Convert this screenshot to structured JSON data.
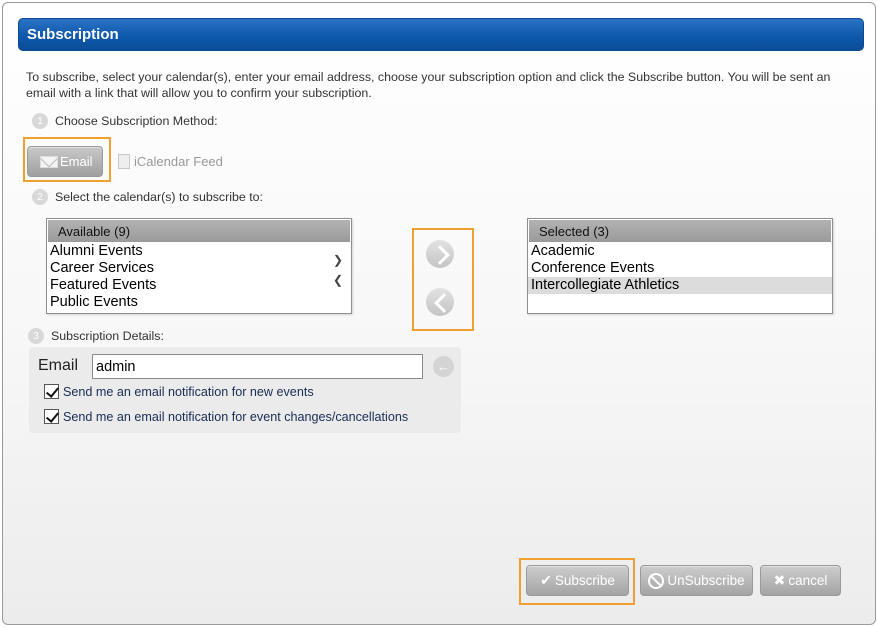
{
  "dialog": {
    "title": "Subscription"
  },
  "intro": "To subscribe, select your calendar(s), enter your email address, choose your subscription option and click the Subscribe button. You will be sent an email with a link that will allow you to confirm your subscription.",
  "steps": [
    {
      "num": "1",
      "label": "Choose Subscription Method:"
    },
    {
      "num": "2",
      "label": "Select the calendar(s) to subscribe to:"
    },
    {
      "num": "3",
      "label": "Subscription Details:"
    }
  ],
  "methods": {
    "email": "Email",
    "ical": "iCalendar Feed"
  },
  "available": {
    "header": "Available (9)",
    "items": [
      "Alumni Events",
      "Career Services",
      "Featured Events",
      "Public Events"
    ]
  },
  "selected": {
    "header": "Selected (3)",
    "items": [
      "Academic",
      "Conference Events",
      "Intercollegiate Athletics"
    ]
  },
  "details": {
    "email_label": "Email",
    "email_value": "admin",
    "options": [
      {
        "label": "Send me an email notification for new events",
        "checked": true
      },
      {
        "label": "Send me an email notification for event changes/cancellations",
        "checked": true
      }
    ]
  },
  "footer": {
    "subscribe": "Subscribe",
    "unsubscribe": "UnSubscribe",
    "cancel": "cancel"
  },
  "colors": {
    "titlebar": "#0f59ac",
    "highlight": "#f0a030"
  }
}
